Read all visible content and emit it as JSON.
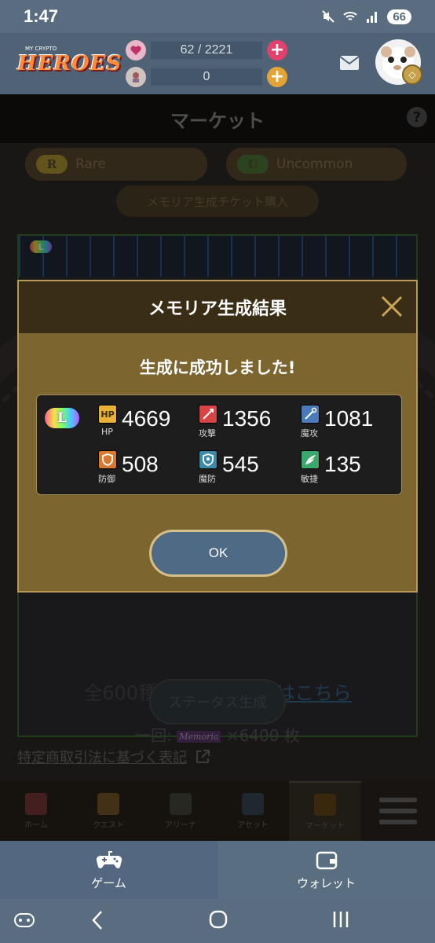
{
  "status_bar": {
    "time": "1:47",
    "battery": "66"
  },
  "header": {
    "logo_text": "HEROES",
    "logo_sub": "MY CRYPTO",
    "stamina": "62 / 2221",
    "currency": "0"
  },
  "page": {
    "title": "マーケット"
  },
  "market": {
    "rarity_rare_badge": "R",
    "rarity_rare_label": "Rare",
    "rarity_uncommon_badge": "U",
    "rarity_uncommon_label": "Uncommon",
    "ticket_button": "メモリア生成チケット購入",
    "banner_badge": "L",
    "banner_text_prefix": "全600種",
    "banner_text_link": "排山率・内容はこちら",
    "cost_prefix": "一回:",
    "cost_chip": "Memoria",
    "cost_suffix": "×6400 枚",
    "generate_button": "ステータス生成",
    "legal_link": "特定商取引法に基づく表記"
  },
  "modal": {
    "title": "メモリア生成結果",
    "message": "生成に成功しました!",
    "rarity_badge": "L",
    "ok_button": "OK",
    "stats": {
      "hp": {
        "label": "HP",
        "icon_text": "HP",
        "value": "4669"
      },
      "attack": {
        "label": "攻撃",
        "value": "1356"
      },
      "magic_attack": {
        "label": "魔攻",
        "value": "1081"
      },
      "defense": {
        "label": "防御",
        "value": "508"
      },
      "magic_defense": {
        "label": "魔防",
        "value": "545"
      },
      "agility": {
        "label": "敏捷",
        "value": "135"
      }
    }
  },
  "game_nav": {
    "home": "ホーム",
    "quest": "クエスト",
    "arena": "アリーナ",
    "asset": "アセット",
    "market": "マーケット"
  },
  "tab_bar": {
    "game": "ゲーム",
    "wallet": "ウォレット"
  },
  "colors": {
    "modal_bg": "#7d6530",
    "modal_head": "#3a2d15",
    "ok_button": "#4f6a84",
    "header_bg": "#4f6276"
  }
}
